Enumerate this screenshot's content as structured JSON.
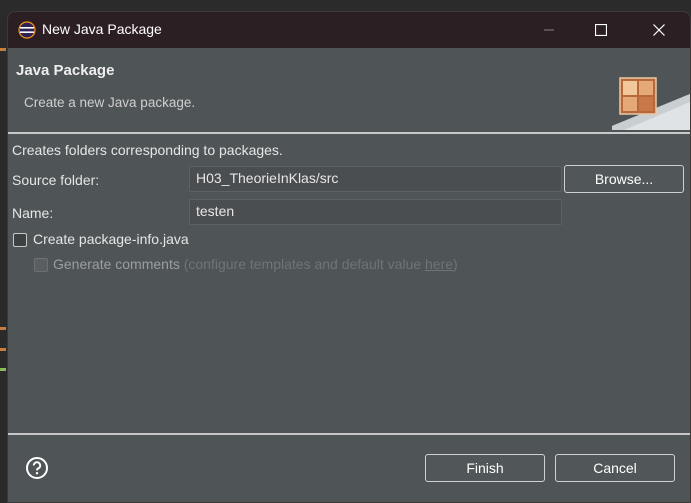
{
  "window": {
    "title": "New Java Package"
  },
  "header": {
    "title": "Java Package",
    "description": "Create a new Java package."
  },
  "form": {
    "intro": "Creates folders corresponding to packages.",
    "source_folder_label": "Source folder:",
    "source_folder_value": "H03_TheorieInKlas/src",
    "browse_label": "Browse...",
    "name_label": "Name:",
    "name_value": "testen",
    "create_package_info_label": "Create package-info.java",
    "create_package_info_checked": false,
    "generate_comments_label": "Generate comments",
    "generate_comments_hint_prefix": "(configure templates and default value ",
    "generate_comments_hint_link": "here",
    "generate_comments_hint_suffix": ")",
    "generate_comments_checked": false,
    "generate_comments_enabled": false
  },
  "footer": {
    "finish_label": "Finish",
    "cancel_label": "Cancel"
  },
  "colors": {
    "dialog_bg": "#4f5457",
    "titlebar_bg": "#2b1f24",
    "text": "#e6e6e6",
    "disabled_text": "#6f7477"
  },
  "icons": {
    "app": "eclipse-icon",
    "minimize": "minimize-icon",
    "maximize": "maximize-icon",
    "close": "close-icon",
    "banner": "package-wizard-banner-icon",
    "help": "help-icon"
  }
}
